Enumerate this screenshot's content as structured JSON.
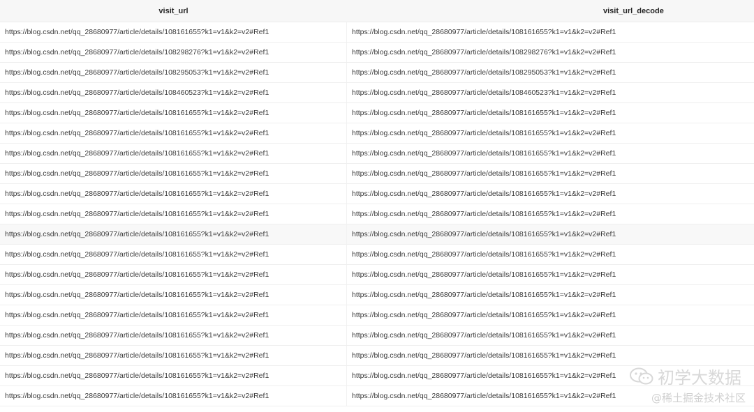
{
  "table": {
    "columns": [
      "visit_url",
      "visit_url_decode"
    ],
    "rows": [
      [
        "https://blog.csdn.net/qq_28680977/article/details/108161655?k1=v1&k2=v2#Ref1",
        "https://blog.csdn.net/qq_28680977/article/details/108161655?k1=v1&k2=v2#Ref1"
      ],
      [
        "https://blog.csdn.net/qq_28680977/article/details/108298276?k1=v1&k2=v2#Ref1",
        "https://blog.csdn.net/qq_28680977/article/details/108298276?k1=v1&k2=v2#Ref1"
      ],
      [
        "https://blog.csdn.net/qq_28680977/article/details/108295053?k1=v1&k2=v2#Ref1",
        "https://blog.csdn.net/qq_28680977/article/details/108295053?k1=v1&k2=v2#Ref1"
      ],
      [
        "https://blog.csdn.net/qq_28680977/article/details/108460523?k1=v1&k2=v2#Ref1",
        "https://blog.csdn.net/qq_28680977/article/details/108460523?k1=v1&k2=v2#Ref1"
      ],
      [
        "https://blog.csdn.net/qq_28680977/article/details/108161655?k1=v1&k2=v2#Ref1",
        "https://blog.csdn.net/qq_28680977/article/details/108161655?k1=v1&k2=v2#Ref1"
      ],
      [
        "https://blog.csdn.net/qq_28680977/article/details/108161655?k1=v1&k2=v2#Ref1",
        "https://blog.csdn.net/qq_28680977/article/details/108161655?k1=v1&k2=v2#Ref1"
      ],
      [
        "https://blog.csdn.net/qq_28680977/article/details/108161655?k1=v1&k2=v2#Ref1",
        "https://blog.csdn.net/qq_28680977/article/details/108161655?k1=v1&k2=v2#Ref1"
      ],
      [
        "https://blog.csdn.net/qq_28680977/article/details/108161655?k1=v1&k2=v2#Ref1",
        "https://blog.csdn.net/qq_28680977/article/details/108161655?k1=v1&k2=v2#Ref1"
      ],
      [
        "https://blog.csdn.net/qq_28680977/article/details/108161655?k1=v1&k2=v2#Ref1",
        "https://blog.csdn.net/qq_28680977/article/details/108161655?k1=v1&k2=v2#Ref1"
      ],
      [
        "https://blog.csdn.net/qq_28680977/article/details/108161655?k1=v1&k2=v2#Ref1",
        "https://blog.csdn.net/qq_28680977/article/details/108161655?k1=v1&k2=v2#Ref1"
      ],
      [
        "https://blog.csdn.net/qq_28680977/article/details/108161655?k1=v1&k2=v2#Ref1",
        "https://blog.csdn.net/qq_28680977/article/details/108161655?k1=v1&k2=v2#Ref1"
      ],
      [
        "https://blog.csdn.net/qq_28680977/article/details/108161655?k1=v1&k2=v2#Ref1",
        "https://blog.csdn.net/qq_28680977/article/details/108161655?k1=v1&k2=v2#Ref1"
      ],
      [
        "https://blog.csdn.net/qq_28680977/article/details/108161655?k1=v1&k2=v2#Ref1",
        "https://blog.csdn.net/qq_28680977/article/details/108161655?k1=v1&k2=v2#Ref1"
      ],
      [
        "https://blog.csdn.net/qq_28680977/article/details/108161655?k1=v1&k2=v2#Ref1",
        "https://blog.csdn.net/qq_28680977/article/details/108161655?k1=v1&k2=v2#Ref1"
      ],
      [
        "https://blog.csdn.net/qq_28680977/article/details/108161655?k1=v1&k2=v2#Ref1",
        "https://blog.csdn.net/qq_28680977/article/details/108161655?k1=v1&k2=v2#Ref1"
      ],
      [
        "https://blog.csdn.net/qq_28680977/article/details/108161655?k1=v1&k2=v2#Ref1",
        "https://blog.csdn.net/qq_28680977/article/details/108161655?k1=v1&k2=v2#Ref1"
      ],
      [
        "https://blog.csdn.net/qq_28680977/article/details/108161655?k1=v1&k2=v2#Ref1",
        "https://blog.csdn.net/qq_28680977/article/details/108161655?k1=v1&k2=v2#Ref1"
      ],
      [
        "https://blog.csdn.net/qq_28680977/article/details/108161655?k1=v1&k2=v2#Ref1",
        "https://blog.csdn.net/qq_28680977/article/details/108161655?k1=v1&k2=v2#Ref1"
      ],
      [
        "https://blog.csdn.net/qq_28680977/article/details/108161655?k1=v1&k2=v2#Ref1",
        "https://blog.csdn.net/qq_28680977/article/details/108161655?k1=v1&k2=v2#Ref1"
      ]
    ],
    "highlighted_row": 10
  },
  "watermark": {
    "main": "初学大数据",
    "sub": "@稀土掘金技术社区",
    "icon": "wechat-icon",
    "color": "#d8d8d8"
  }
}
